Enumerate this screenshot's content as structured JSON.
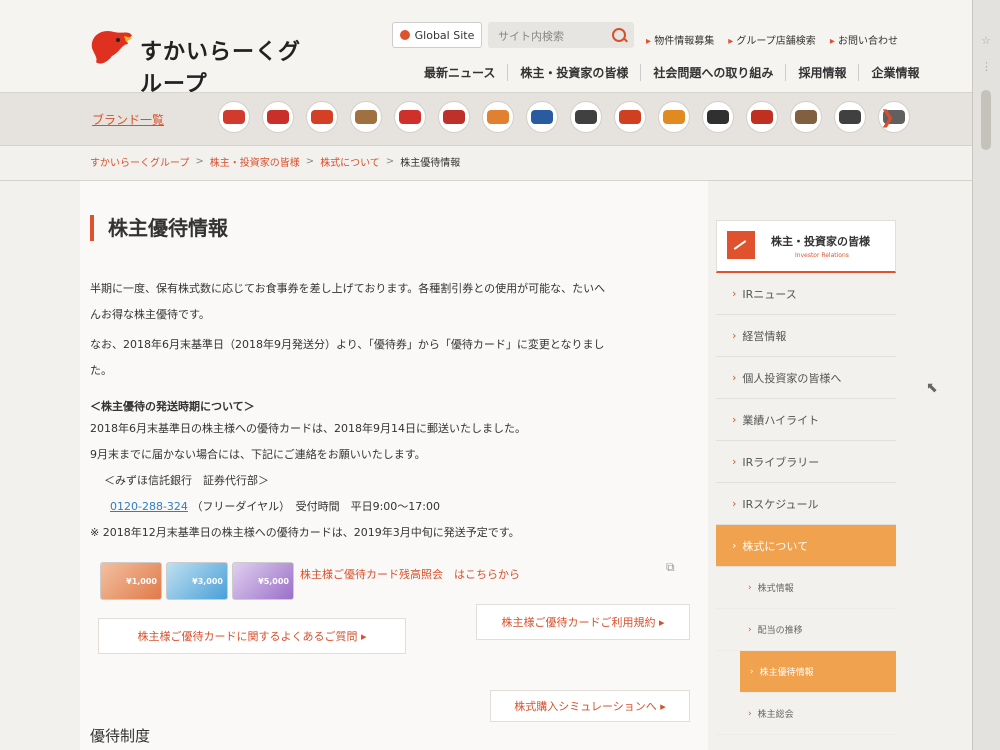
{
  "header": {
    "logo_text": "すかいらーくグループ",
    "global_site": "Global Site",
    "search_placeholder": "サイト内検索",
    "top_links": [
      "物件情報募集",
      "グループ店舗検索",
      "お問い合わせ"
    ],
    "main_nav": [
      "最新ニュース",
      "株主・投資家の皆様",
      "社会問題への取り組み",
      "採用情報",
      "企業情報"
    ]
  },
  "brand_bar": {
    "label": "ブランド一覧",
    "brands": [
      {
        "name": "brand-gusto",
        "color": "#d23a2e"
      },
      {
        "name": "brand-bamiyan",
        "color": "#c9302a"
      },
      {
        "name": "brand-jonathans",
        "color": "#d34026"
      },
      {
        "name": "brand-shabuyo",
        "color": "#a07040"
      },
      {
        "name": "brand-yumean",
        "color": "#d0302a"
      },
      {
        "name": "brand-steak-gusto",
        "color": "#c0302a"
      },
      {
        "name": "brand-grazie",
        "color": "#e08030"
      },
      {
        "name": "brand-aiya",
        "color": "#2a5aa0"
      },
      {
        "name": "brand-chawan",
        "color": "#404040"
      },
      {
        "name": "brand-karayoshi",
        "color": "#d04020"
      },
      {
        "name": "brand-la-ohana",
        "color": "#e08a20"
      },
      {
        "name": "brand-chawan-2",
        "color": "#303030"
      },
      {
        "name": "brand-tonkarakun",
        "color": "#c03020"
      },
      {
        "name": "brand-yumeshokudo",
        "color": "#806040"
      },
      {
        "name": "brand-ikiya",
        "color": "#404040"
      },
      {
        "name": "brand-toriyoshi",
        "color": "#606060"
      }
    ]
  },
  "breadcrumb": [
    "すかいらーくグループ",
    "株主・投資家の皆様",
    "株式について",
    "株主優待情報"
  ],
  "page": {
    "title": "株主優待情報",
    "para1a": "半期に一度、保有株式数に応じてお食事券を差し上げております。各種割引券との使用が可能な、たいへ",
    "para1b": "んお得な株主優待です。",
    "para2a": "なお、2018年6月末基準日（2018年9月発送分）より、「優待券」から「優待カード」に変更となりまし",
    "para2b": "た。",
    "sub_heading": "＜株主優待の発送時期について＞",
    "line1": "2018年6月末基準日の株主様への優待カードは、2018年9月14日に郵送いたしました。",
    "line2": "9月末までに届かない場合には、下記にご連絡をお願いいたします。",
    "line3": "＜みずほ信託銀行　証券代行部＞",
    "phone": "0120-288-324",
    "phone_note": "（フリーダイヤル）　受付時間　平日9:00～17:00",
    "note": "※ 2018年12月末基準日の株主様への優待カードは、2019年3月中旬に発送予定です。",
    "cards": [
      "¥1,000",
      "¥3,000",
      "¥5,000"
    ],
    "card_link": "株主様ご優待カード残高照会　はこちらから",
    "faq_button": "株主様ご優待カードに関するよくあるご質問 ▸",
    "terms_button": "株主様ご優待カードご利用規約 ▸",
    "sim_button": "株式購入シミュレーションへ ▸",
    "section2": "優待制度"
  },
  "sidebar": {
    "title": "株主・投資家の皆様",
    "subtitle": "Investor Relations",
    "items": [
      "IRニュース",
      "経営情報",
      "個人投資家の皆様へ",
      "業績ハイライト",
      "IRライブラリー",
      "IRスケジュール",
      "株式について"
    ],
    "subitems": [
      "株式情報",
      "配当の推移",
      "株主優待情報",
      "株主総会"
    ]
  }
}
